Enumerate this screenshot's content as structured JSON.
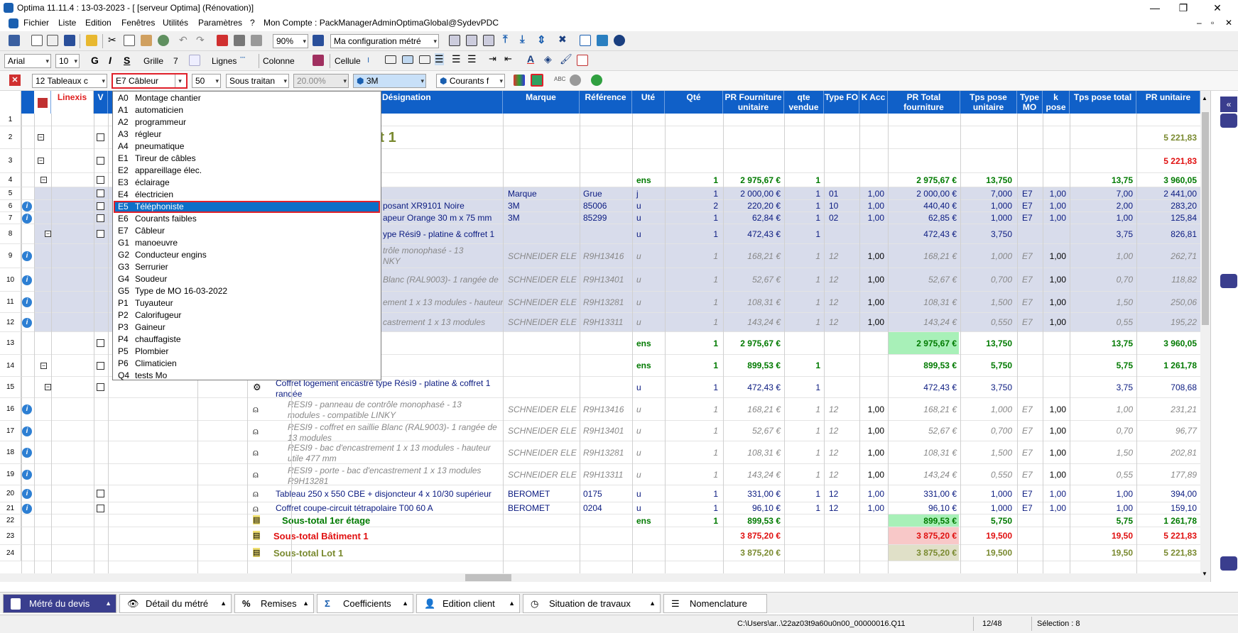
{
  "app": {
    "title": "Optima 11.11.4 : 13-03-2023 - [ [serveur Optima] (Rénovation)]",
    "window_controls": [
      "—",
      "❐",
      "✕"
    ],
    "mdi_controls": [
      "–",
      "▫",
      "✕"
    ]
  },
  "menubar": {
    "items": [
      "Fichier",
      "Liste",
      "Edition",
      "Fenêtres",
      "Utilités",
      "Paramètres",
      "?",
      "Mon Compte : PackManagerAdminOptimaGlobal@SydevPDC"
    ]
  },
  "toolbar1": {
    "zoom": "90%",
    "config": "Ma configuration métré"
  },
  "toolbar2": {
    "font": "Arial",
    "size": "10",
    "bold": "G",
    "italic": "I",
    "strike": "S",
    "grille_label": "Grille",
    "grille_value": "7",
    "lignes_label": "Lignes",
    "colonne_label": "Colonne",
    "cellule_label": "Cellule"
  },
  "toolbar3": {
    "tableaux": "12  Tableaux c",
    "cableur": "E7   Câbleur",
    "fifty": "50",
    "sous_traitant": "Sous traitan",
    "percent": "20.00%",
    "brand": "3M",
    "courants": "Courants f"
  },
  "grid": {
    "headers": [
      "Linexis",
      "V",
      "Désignation",
      "Marque",
      "Référence",
      "Uté",
      "Qté",
      "PR Fourniture unitaire",
      "qte vendue",
      "Type FO",
      "K Acc",
      "PR Total fourniture",
      "Tps pose unitaire",
      "Type MO",
      "k pose",
      "Tps pose total",
      "PR unitaire"
    ],
    "lot_title": "Lot 1",
    "rows": [
      {
        "n": "1"
      },
      {
        "n": "2",
        "pr": "5 221,83"
      },
      {
        "n": "3",
        "pr": "5 221,83"
      },
      {
        "n": "4",
        "ute": "ens",
        "qte": "1",
        "pfu": "2 975,67 €",
        "qv": "1",
        "ptf": "2 975,67 €",
        "tpu": "13,750",
        "tpt": "13,75",
        "pr": "3 960,05"
      },
      {
        "n": "5",
        "marque": "Marque",
        "ref": "Grue",
        "ute": "j",
        "qte": "1",
        "pfu": "2 000,00 €",
        "qv": "1",
        "tfo": "01",
        "kacc": "1,00",
        "ptf": "2 000,00 €",
        "tpu": "7,000",
        "tmo": "E7",
        "kp": "1,00",
        "tpt": "7,00",
        "pr": "2 441,00"
      },
      {
        "n": "6",
        "des": "posant XR9101 Noire",
        "marque": "3M",
        "ref": "85006",
        "ute": "u",
        "qte": "2",
        "pfu": "220,20 €",
        "qv": "1",
        "tfo": "10",
        "kacc": "1,00",
        "ptf": "440,40 €",
        "tpu": "1,000",
        "tmo": "E7",
        "kp": "1,00",
        "tpt": "2,00",
        "pr": "283,20"
      },
      {
        "n": "7",
        "des": "apeur Orange 30 m x 75 mm",
        "marque": "3M",
        "ref": "85299",
        "ute": "u",
        "qte": "1",
        "pfu": "62,84 €",
        "qv": "1",
        "tfo": "02",
        "kacc": "1,00",
        "ptf": "62,85 €",
        "tpu": "1,000",
        "tmo": "E7",
        "kp": "1,00",
        "tpt": "1,00",
        "pr": "125,84"
      },
      {
        "n": "8",
        "des": "ype Rési9 - platine & coffret 1",
        "ute": "u",
        "qte": "1",
        "pfu": "472,43 €",
        "qv": "1",
        "ptf": "472,43 €",
        "tpu": "3,750",
        "tpt": "3,75",
        "pr": "826,81"
      },
      {
        "n": "9",
        "des": "trôle monophasé - 13",
        "des2": "NKY",
        "marque": "SCHNEIDER ELE",
        "ref": "R9H13416",
        "ute": "u",
        "qte": "1",
        "pfu": "168,21 €",
        "qv": "1",
        "tfo": "12",
        "kacc": "1,00",
        "ptf": "168,21 €",
        "tpu": "1,000",
        "tmo": "E7",
        "kp": "1,00",
        "tpt": "1,00",
        "pr": "262,71"
      },
      {
        "n": "10",
        "des": "Blanc (RAL9003)- 1 rangée de",
        "marque": "SCHNEIDER ELE",
        "ref": "R9H13401",
        "ute": "u",
        "qte": "1",
        "pfu": "52,67 €",
        "qv": "1",
        "tfo": "12",
        "kacc": "1,00",
        "ptf": "52,67 €",
        "tpu": "0,700",
        "tmo": "E7",
        "kp": "1,00",
        "tpt": "0,70",
        "pr": "118,82"
      },
      {
        "n": "11",
        "des": "ement 1 x 13 modules - hauteur",
        "marque": "SCHNEIDER ELE",
        "ref": "R9H13281",
        "ute": "u",
        "qte": "1",
        "pfu": "108,31 €",
        "qv": "1",
        "tfo": "12",
        "kacc": "1,00",
        "ptf": "108,31 €",
        "tpu": "1,500",
        "tmo": "E7",
        "kp": "1,00",
        "tpt": "1,50",
        "pr": "250,06"
      },
      {
        "n": "12",
        "des": "castrement 1 x 13 modules",
        "marque": "SCHNEIDER ELE",
        "ref": "R9H13311",
        "ute": "u",
        "qte": "1",
        "pfu": "143,24 €",
        "qv": "1",
        "tfo": "12",
        "kacc": "1,00",
        "ptf": "143,24 €",
        "tpu": "0,550",
        "tmo": "E7",
        "kp": "1,00",
        "tpt": "0,55",
        "pr": "195,22"
      },
      {
        "n": "13",
        "ute": "ens",
        "qte": "1",
        "pfu": "2 975,67 €",
        "ptf": "2 975,67 €",
        "tpu": "13,750",
        "tpt": "13,75",
        "pr": "3 960,05"
      },
      {
        "n": "14",
        "ute": "ens",
        "qte": "1",
        "pfu": "899,53 €",
        "qv": "1",
        "ptf": "899,53 €",
        "tpu": "5,750",
        "tpt": "5,75",
        "pr": "1 261,78"
      },
      {
        "n": "15",
        "des": "Coffret logement encastré type Résì9 - platine & coffret 1",
        "des2": "rangée",
        "ute": "u",
        "qte": "1",
        "pfu": "472,43 €",
        "qv": "1",
        "ptf": "472,43 €",
        "tpu": "3,750",
        "tpt": "3,75",
        "pr": "708,68"
      },
      {
        "n": "16",
        "des": "RESI9 - panneau de contrôle monophasé - 13",
        "des2": "modules - compatible LINKY",
        "marque": "SCHNEIDER ELE",
        "ref": "R9H13416",
        "ute": "u",
        "qte": "1",
        "pfu": "168,21 €",
        "qv": "1",
        "tfo": "12",
        "kacc": "1,00",
        "ptf": "168,21 €",
        "tpu": "1,000",
        "tmo": "E7",
        "kp": "1,00",
        "tpt": "1,00",
        "pr": "231,21"
      },
      {
        "n": "17",
        "des": "RESI9 - coffret en saillie Blanc (RAL9003)- 1 rangée de",
        "des2": "13 modules",
        "marque": "SCHNEIDER ELE",
        "ref": "R9H13401",
        "ute": "u",
        "qte": "1",
        "pfu": "52,67 €",
        "qv": "1",
        "tfo": "12",
        "kacc": "1,00",
        "ptf": "52,67 €",
        "tpu": "0,700",
        "tmo": "E7",
        "kp": "1,00",
        "tpt": "0,70",
        "pr": "96,77"
      },
      {
        "n": "18",
        "des": "RESI9 - bac d'encastrement 1 x 13 modules - hauteur",
        "des2": "utile 477 mm",
        "marque": "SCHNEIDER ELE",
        "ref": "R9H13281",
        "ute": "u",
        "qte": "1",
        "pfu": "108,31 €",
        "qv": "1",
        "tfo": "12",
        "kacc": "1,00",
        "ptf": "108,31 €",
        "tpu": "1,500",
        "tmo": "E7",
        "kp": "1,00",
        "tpt": "1,50",
        "pr": "202,81"
      },
      {
        "n": "19",
        "des": "RESI9 - porte - bac d'encastrement 1 x 13 modules",
        "des2": "R9H13281",
        "marque": "SCHNEIDER ELE",
        "ref": "R9H13311",
        "ute": "u",
        "qte": "1",
        "pfu": "143,24 €",
        "qv": "1",
        "tfo": "12",
        "kacc": "1,00",
        "ptf": "143,24 €",
        "tpu": "0,550",
        "tmo": "E7",
        "kp": "1,00",
        "tpt": "0,55",
        "pr": "177,89"
      },
      {
        "n": "20",
        "des": "Tableau 250 x 550 CBE + disjoncteur 4 x 10/30 supérieur",
        "marque": "BEROMET",
        "ref": "0175",
        "ute": "u",
        "qte": "1",
        "pfu": "331,00 €",
        "qv": "1",
        "tfo": "12",
        "kacc": "1,00",
        "ptf": "331,00 €",
        "tpu": "1,000",
        "tmo": "E7",
        "kp": "1,00",
        "tpt": "1,00",
        "pr": "394,00"
      },
      {
        "n": "21",
        "des": "Coffret coupe-circuit tétrapolaire T00 60 A",
        "marque": "BEROMET",
        "ref": "0204",
        "ute": "u",
        "qte": "1",
        "pfu": "96,10 €",
        "qv": "1",
        "tfo": "12",
        "kacc": "1,00",
        "ptf": "96,10 €",
        "tpu": "1,000",
        "tmo": "E7",
        "kp": "1,00",
        "tpt": "1,00",
        "pr": "159,10"
      },
      {
        "n": "22",
        "des": "Sous-total 1er étage",
        "ute": "ens",
        "qte": "1",
        "pfu": "899,53 €",
        "ptf": "899,53 €",
        "tpu": "5,750",
        "tpt": "5,75",
        "pr": "1 261,78"
      },
      {
        "n": "23",
        "des": "Sous-total Bâtiment 1",
        "pfu": "3 875,20 €",
        "ptf": "3 875,20 €",
        "tpu": "19,500",
        "tpt": "19,50",
        "pr": "5 221,83"
      },
      {
        "n": "24",
        "des": "Sous-total Lot 1",
        "pfu": "3 875,20 €",
        "ptf": "3 875,20 €",
        "tpu": "19,500",
        "tpt": "19,50",
        "pr": "5 221,83"
      }
    ]
  },
  "dropdown": {
    "items": [
      {
        "code": "A0",
        "label": "Montage chantier"
      },
      {
        "code": "A1",
        "label": "automaticien"
      },
      {
        "code": "A2",
        "label": "programmeur"
      },
      {
        "code": "A3",
        "label": "régleur"
      },
      {
        "code": "A4",
        "label": "pneumatique"
      },
      {
        "code": "E1",
        "label": "Tireur de câbles"
      },
      {
        "code": "E2",
        "label": "appareillage élec."
      },
      {
        "code": "E3",
        "label": "éclairage"
      },
      {
        "code": "E4",
        "label": "électricien"
      },
      {
        "code": "E5",
        "label": "Téléphoniste"
      },
      {
        "code": "E6",
        "label": "Courants faibles"
      },
      {
        "code": "E7",
        "label": "Câbleur"
      },
      {
        "code": "G1",
        "label": "manoeuvre"
      },
      {
        "code": "G2",
        "label": "Conducteur engins"
      },
      {
        "code": "G3",
        "label": "Serrurier"
      },
      {
        "code": "G4",
        "label": "Soudeur"
      },
      {
        "code": "G5",
        "label": "Type de MO 16-03-2022"
      },
      {
        "code": "P1",
        "label": "Tuyauteur"
      },
      {
        "code": "P2",
        "label": "Calorifugeur"
      },
      {
        "code": "P3",
        "label": "Gaineur"
      },
      {
        "code": "P4",
        "label": "chauffagiste"
      },
      {
        "code": "P5",
        "label": "Plombier"
      },
      {
        "code": "P6",
        "label": "Climaticien"
      },
      {
        "code": "Q4",
        "label": "tests Mo"
      }
    ],
    "selected_index": 9
  },
  "bottom_tabs": [
    "Métré du devis",
    "Détail du métré",
    "Remises",
    "Coefficients",
    "Edition client",
    "Situation de travaux",
    "Nomenclature"
  ],
  "statusbar": {
    "path": "C:\\Users\\ar..\\22az03t9a60u0n00_00000016.Q11",
    "count": "12/48",
    "selection": "Sélection : 8"
  },
  "colors": {
    "header_blue": "#1060c8",
    "row_blue": "#d8dceb",
    "highlight": "#0b6fc8",
    "red_box": "#e0202a",
    "green_total": "#007a00",
    "bottom_active": "#3a3e8e"
  }
}
